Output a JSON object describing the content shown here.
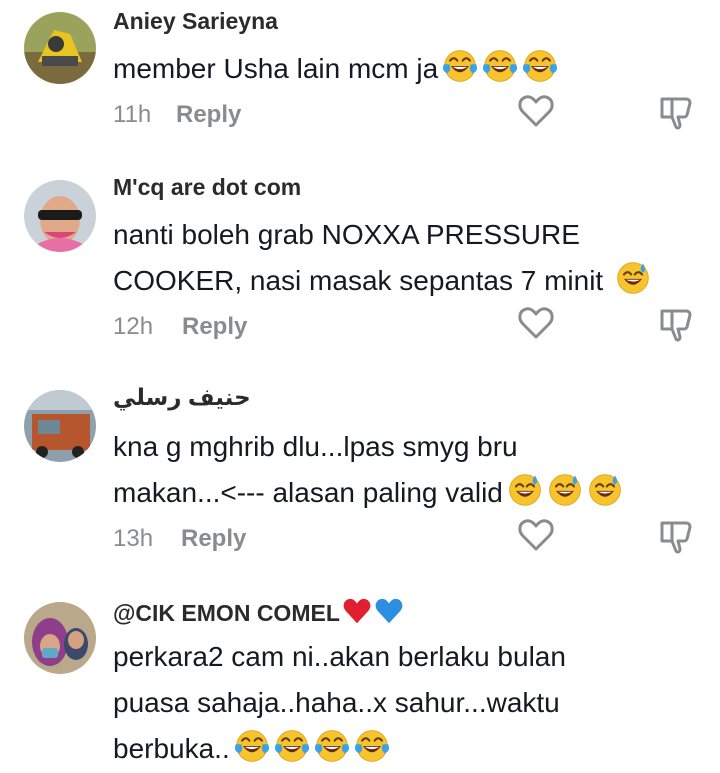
{
  "comments": [
    {
      "username": "Aniey Sarieyna",
      "text": "member Usha lain mcm ja",
      "emojis": [
        "laugh-cry",
        "laugh-cry",
        "laugh-cry"
      ],
      "time": "11h",
      "reply": "Reply"
    },
    {
      "username": "M'cq are dot com",
      "text": "nanti boleh grab NOXXA PRESSURE\nCOOKER, nasi masak sepantas 7 minit ",
      "emojis": [
        "sweat-smile"
      ],
      "time": "12h",
      "reply": "Reply"
    },
    {
      "username": "حنيف رسلي",
      "text": "kna g mghrib dlu...lpas smyg bru\nmakan...<--- alasan paling valid",
      "emojis": [
        "sweat-smile",
        "sweat-smile",
        "sweat-smile"
      ],
      "time": "13h",
      "reply": "Reply"
    },
    {
      "username": "@CIK EMON COMEL",
      "username_emojis": [
        "red-heart",
        "blue-heart"
      ],
      "text": "perkara2 cam ni..akan berlaku bulan\npuasa sahaja..haha..x sahur...waktu\nberbuka..",
      "emojis": [
        "laugh-cry",
        "laugh-cry",
        "laugh-cry",
        "laugh-cry"
      ],
      "time": "",
      "reply": ""
    }
  ],
  "colors": {
    "text": "#161823",
    "username": "#2b2b2b",
    "muted": "#8a8b91",
    "emoji_face": "#f7c42d",
    "tear": "#3ba1e6",
    "red_heart": "#e0202f",
    "blue_heart": "#2c8ee0"
  }
}
